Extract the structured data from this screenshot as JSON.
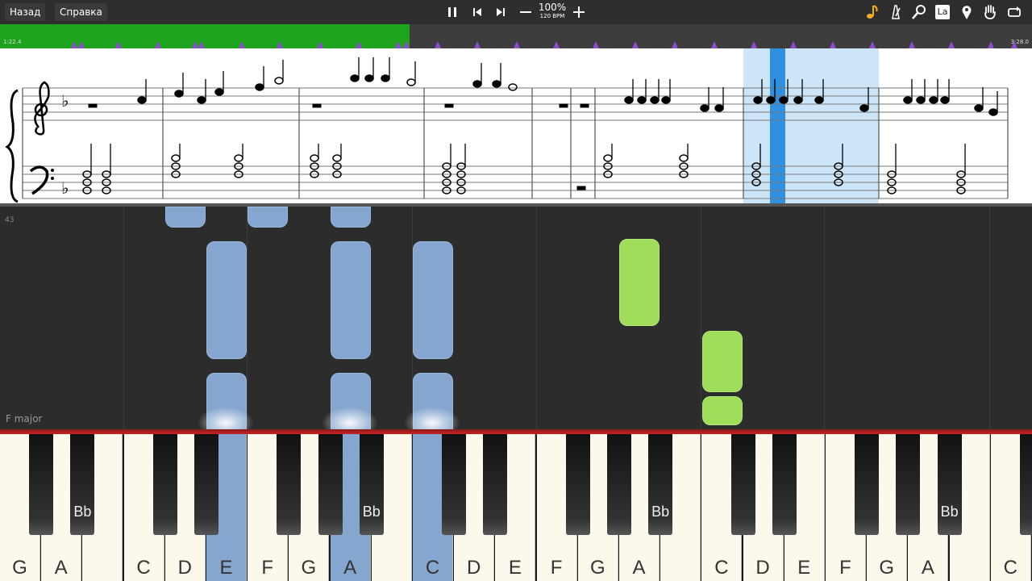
{
  "toolbar": {
    "back_label": "Назад",
    "help_label": "Справка",
    "zoom": "100%",
    "bpm": "120 BPM",
    "notation_label": "La"
  },
  "timeline": {
    "start_time": "1:22.4",
    "end_time": "3:28.0",
    "progress": 0.397,
    "played_color": "#1ea31e",
    "marker_color": "#8d4dd0"
  },
  "roll": {
    "measure_number": "43",
    "key_label": "F major",
    "colors": {
      "left_hand": "#85a6cf",
      "right_hand": "#9fdd5a"
    }
  },
  "keyboard": {
    "white_keys": [
      "G",
      "A",
      "",
      "C",
      "D",
      "E",
      "F",
      "G",
      "A",
      "",
      "C",
      "D",
      "E",
      "F",
      "G",
      "A",
      "",
      "C",
      "D",
      "E",
      "F",
      "G",
      "A",
      "",
      "C"
    ],
    "black_key_label": "Bb",
    "active_keys": [
      "E",
      "A",
      "C"
    ]
  }
}
